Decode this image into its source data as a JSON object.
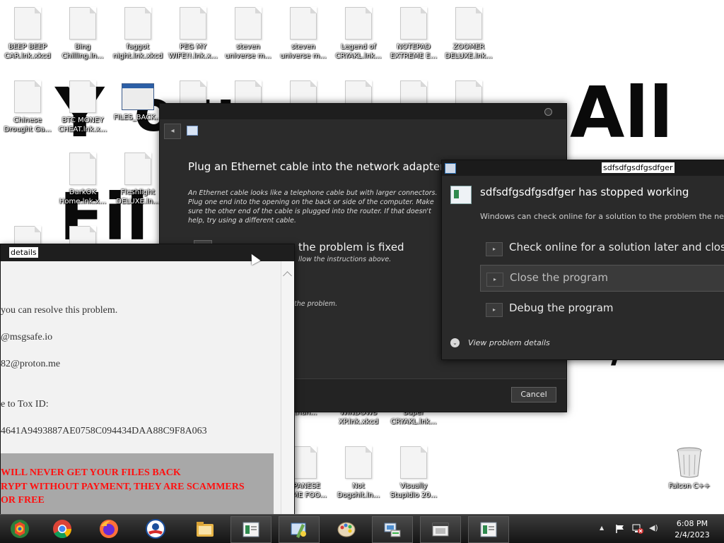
{
  "wallpaper_text": [
    "Y",
    "o",
    "u",
    "All",
    "Fil"
  ],
  "desktop_icons": [
    {
      "label": "BEEP BEEP CAR.lnk.xkcd",
      "type": "doc"
    },
    {
      "label": "Bing Chilling.ln...",
      "type": "doc"
    },
    {
      "label": "faggot night.lnk.xkcd",
      "type": "doc"
    },
    {
      "label": "PEG MY WIFE!!.lnk.x...",
      "type": "doc"
    },
    {
      "label": "steven universe m...",
      "type": "doc"
    },
    {
      "label": "steven universe m...",
      "type": "doc"
    },
    {
      "label": "Legend of CRYAKL.lnk...",
      "type": "doc"
    },
    {
      "label": "NOTEPAD EXTREME E...",
      "type": "doc"
    },
    {
      "label": "ZOOMER DELUXE.lnk...",
      "type": "doc"
    },
    {
      "label": "Chinese Drought Ga...",
      "type": "doc"
    },
    {
      "label": "BTC MONEY CHEAT.lnk.x...",
      "type": "doc"
    },
    {
      "label": "FILES_BACK...",
      "type": "window"
    },
    {
      "label": "DarkOK Home.lnk.x...",
      "type": "doc"
    },
    {
      "label": "Fleshlight DELUXE.ln...",
      "type": "doc"
    },
    {
      "label": "Ethan...",
      "type": "partial"
    },
    {
      "label": "WINDOWS XP.lnk.xkcd",
      "type": "partial"
    },
    {
      "label": "Super CRYAKL.lnk...",
      "type": "partial"
    },
    {
      "label": "JAPANESE ANIME FOO...",
      "type": "doc"
    },
    {
      "label": "Not Dogshit.ln...",
      "type": "doc"
    },
    {
      "label": "Visually Stupidio 20...",
      "type": "doc"
    },
    {
      "label": "Falcon C++",
      "type": "trash"
    }
  ],
  "network_dialog": {
    "back_glyph": "◂",
    "heading": "Plug an Ethernet cable into the network adapter",
    "description": "An Ethernet cable looks like a telephone cable but with larger connectors. Plug one end into the opening on the back or side of the computer. Make sure the other end of the cable is plugged into the router. If that doesn't help, try using a different cable.",
    "step_text": "the problem is fixed",
    "step_sub": "llow the instructions above.",
    "problem_text": "the problem.",
    "cancel_label": "Cancel"
  },
  "crash_dialog": {
    "window_title": "sdfsdfgsdfgsdfger",
    "heading": "sdfsdfgsdfgsdfger has stopped working",
    "subtext": "Windows can check online for a solution to the problem the next tim",
    "option_arrow": "▸",
    "options": [
      "Check online for a solution later and close",
      "Close the program",
      "Debug the program"
    ],
    "details_glyph": "⌄",
    "view_details": "View problem details"
  },
  "ransom_note": {
    "window_title": "details",
    "lines": [
      "you can resolve this problem.",
      "@msgsafe.io",
      "82@proton.me",
      "e to Tox ID:",
      "4641A9493887AE0758C094434DAA88C9F8A063"
    ],
    "warning_lines": [
      "WILL NEVER GET YOUR FILES BACK",
      "RYPT WITHOUT PAYMENT, THEY ARE SCAMMERS",
      "OR FREE"
    ]
  },
  "taskbar": {
    "apps": [
      {
        "name": "start-button",
        "icon": "start-orb-icon",
        "open": false
      },
      {
        "name": "chrome",
        "icon": "chrome-icon",
        "open": false
      },
      {
        "name": "firefox",
        "icon": "firefox-icon",
        "open": false
      },
      {
        "name": "obama",
        "icon": "obama-logo-icon",
        "open": false
      },
      {
        "name": "explorer",
        "icon": "folder-icon",
        "open": false
      },
      {
        "name": "window-1",
        "icon": "app-window-icon",
        "open": true
      },
      {
        "name": "window-2",
        "icon": "network-diagnostics-icon",
        "open": true
      },
      {
        "name": "paint",
        "icon": "paint-palette-icon",
        "open": false
      },
      {
        "name": "window-3",
        "icon": "network-computer-icon",
        "open": true
      },
      {
        "name": "window-4",
        "icon": "error-window-icon",
        "open": true
      },
      {
        "name": "window-5",
        "icon": "app-window-icon",
        "open": true
      }
    ],
    "tray_glyphs": {
      "show_hidden": "▲",
      "volume": "◀)"
    },
    "time": "6:08 PM",
    "date": "2/4/2023"
  }
}
